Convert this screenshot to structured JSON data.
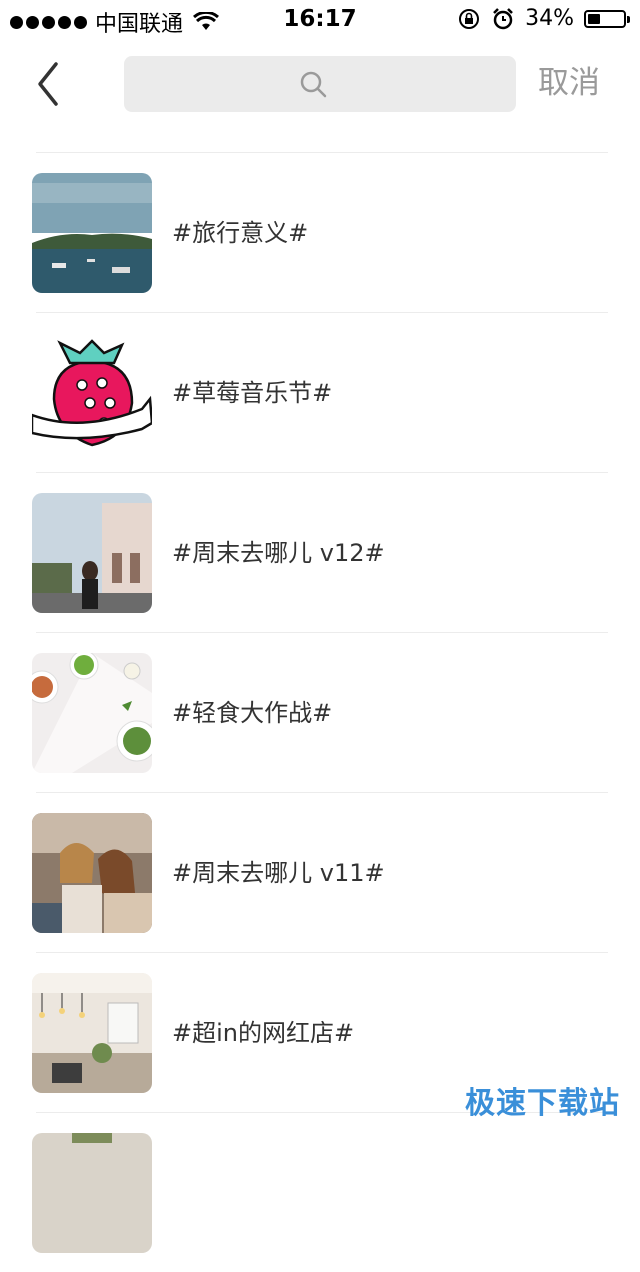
{
  "status_bar": {
    "carrier": "中国联通",
    "time": "16:17",
    "battery_percent_text": "34%",
    "battery_level": 0.34
  },
  "search": {
    "placeholder": "",
    "value": "",
    "cancel_label": "取消"
  },
  "topics": [
    {
      "label": "#旅行意义#",
      "thumb_icon": "harbor-photo"
    },
    {
      "label": "#草莓音乐节#",
      "thumb_icon": "strawberry-logo"
    },
    {
      "label": "#周末去哪儿 v12#",
      "thumb_icon": "street-photo"
    },
    {
      "label": "#轻食大作战#",
      "thumb_icon": "salad-photo"
    },
    {
      "label": "#周末去哪儿 v11#",
      "thumb_icon": "friends-photo"
    },
    {
      "label": "#超in的网红店#",
      "thumb_icon": "cafe-photo"
    }
  ],
  "watermark": "极速下载站",
  "colors": {
    "search_bg": "#ebebeb",
    "cancel_text": "#9a9a9a",
    "divider": "#ececec",
    "watermark": "#3a8fd9"
  }
}
